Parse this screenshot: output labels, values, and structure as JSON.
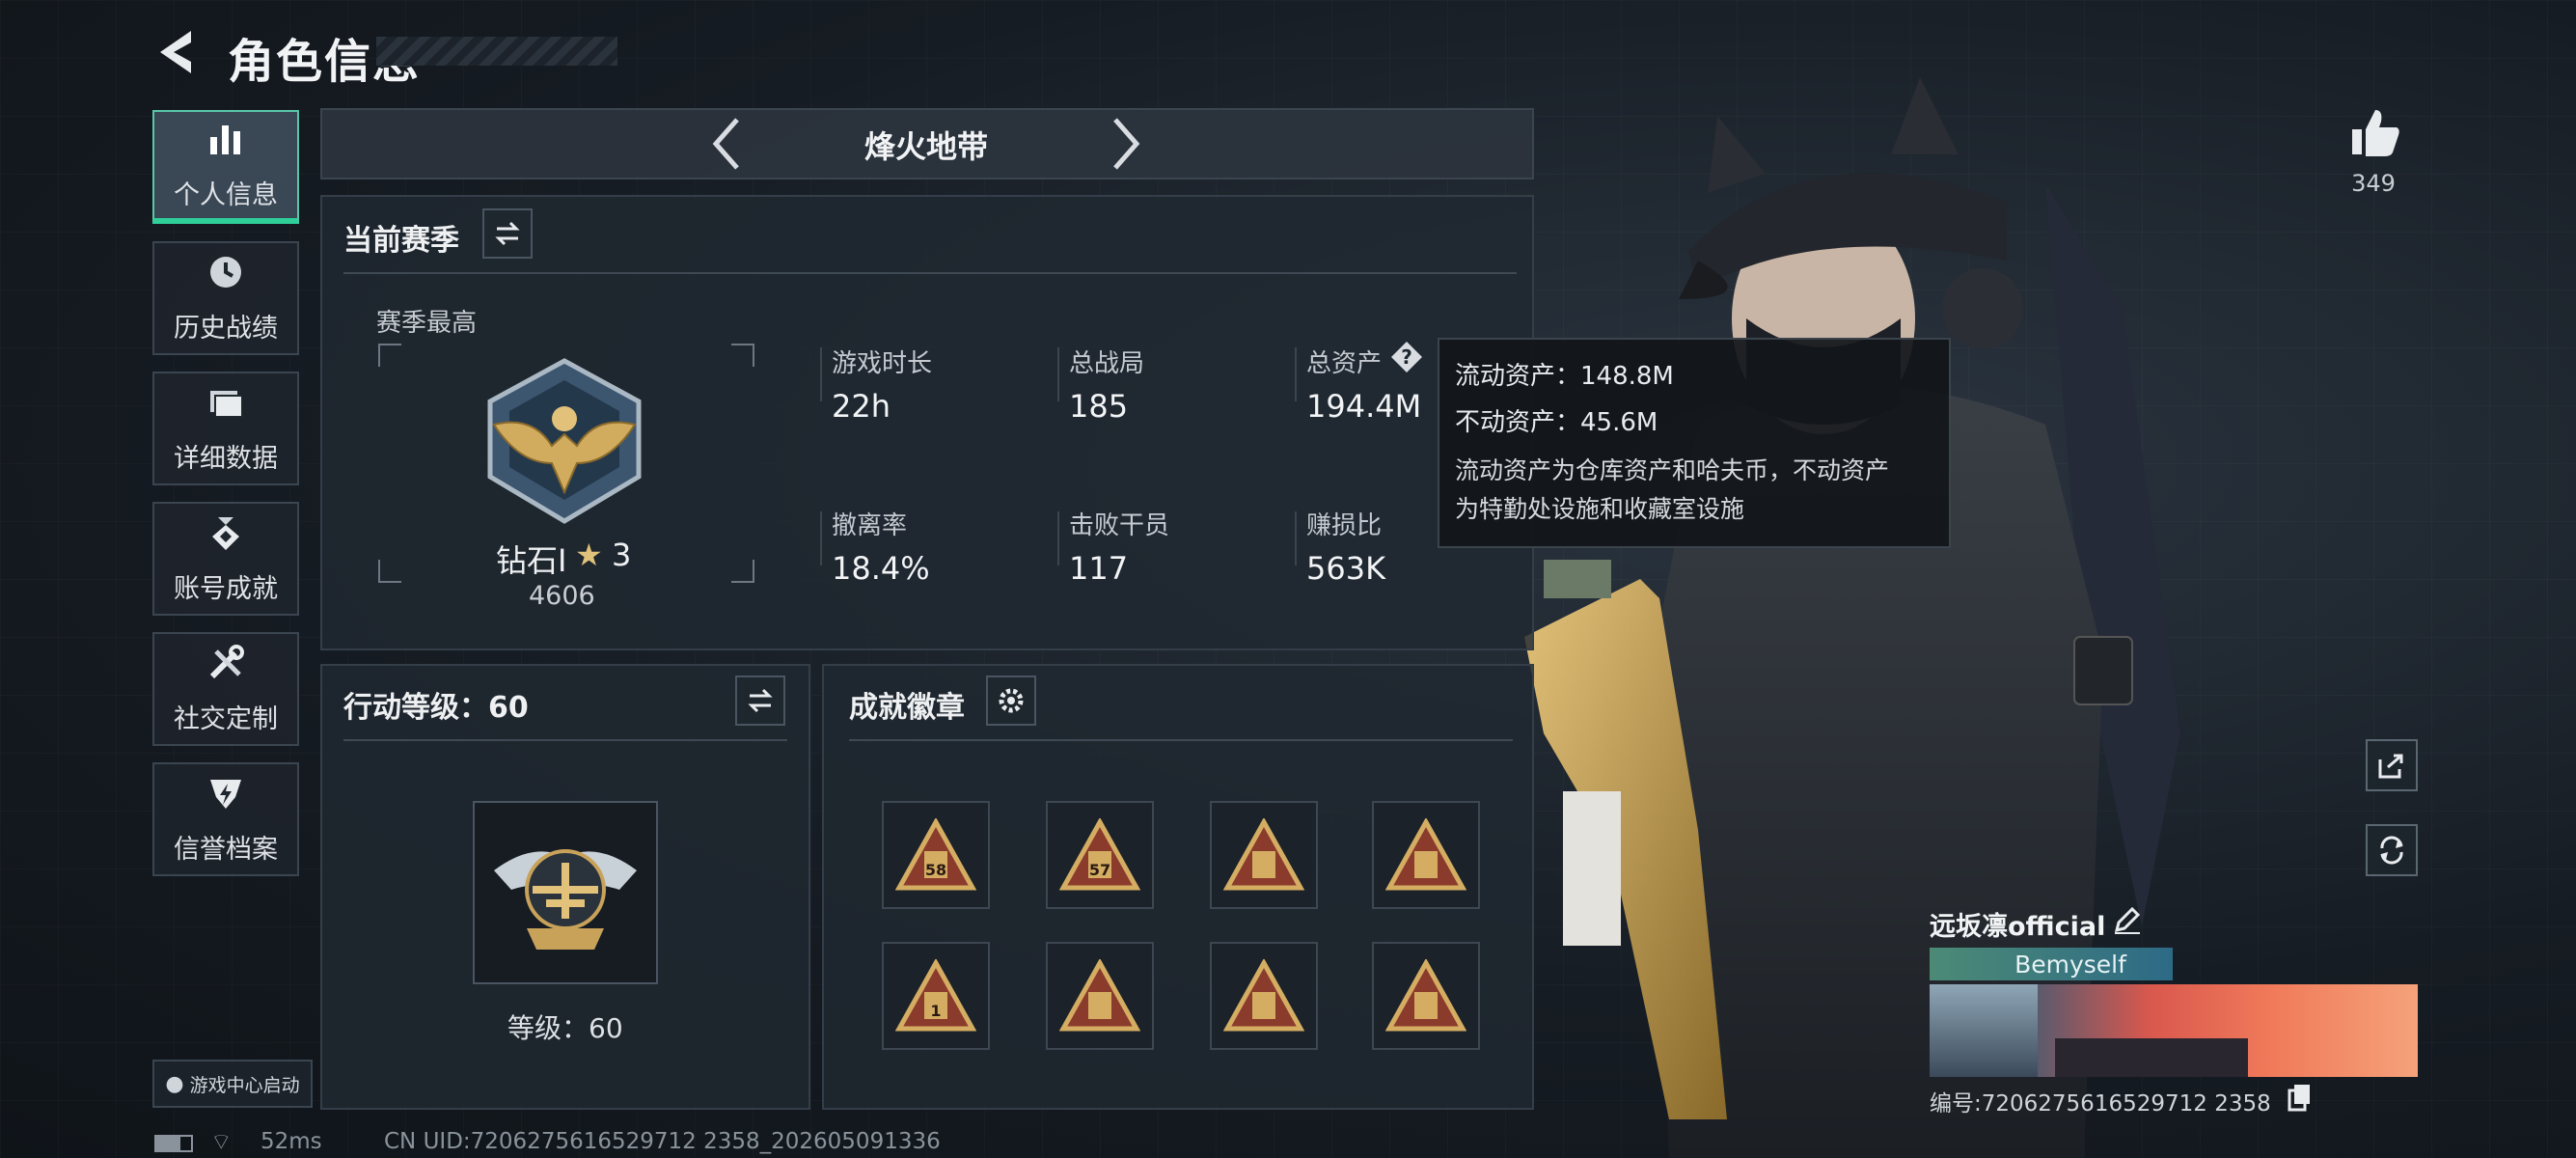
{
  "header": {
    "title": "角色信息"
  },
  "nav": [
    {
      "label": "个人信息",
      "icon": "bar-chart-icon",
      "glyph": "📊",
      "active": true
    },
    {
      "label": "历史战绩",
      "icon": "clock-icon",
      "glyph": "🕓",
      "active": false
    },
    {
      "label": "详细数据",
      "icon": "folder-icon",
      "glyph": "🗀",
      "active": false
    },
    {
      "label": "账号成就",
      "icon": "medal-icon",
      "glyph": "✪",
      "active": false
    },
    {
      "label": "社交定制",
      "icon": "tools-icon",
      "glyph": "🛠",
      "active": false
    },
    {
      "label": "信誉档案",
      "icon": "shield-bolt-icon",
      "glyph": "⛉",
      "active": false
    }
  ],
  "mode_selector": {
    "label": "烽火地带"
  },
  "season": {
    "title": "当前赛季",
    "best_label": "赛季最高",
    "rank_name": "钻石I",
    "rank_stars": "3",
    "rank_points": "4606",
    "stats": [
      {
        "label": "游戏时长",
        "value": "22h"
      },
      {
        "label": "总战局",
        "value": "185"
      },
      {
        "label": "总资产",
        "value": "194.4M"
      },
      {
        "label": "撤离率",
        "value": "18.4%"
      },
      {
        "label": "击败干员",
        "value": "117"
      },
      {
        "label": "赚损比",
        "value": "563K"
      }
    ]
  },
  "tooltip": {
    "liquid": "流动资产：148.8M",
    "fixed": "不动资产：45.6M",
    "desc1": "流动资产为仓库资产和哈夫币，不动资产",
    "desc2": "为特勤处设施和收藏室设施"
  },
  "action_level": {
    "title": "行动等级：60",
    "level_text": "等级：60"
  },
  "achievements": {
    "title": "成就徽章",
    "badges": [
      "58",
      "57",
      "",
      "",
      "1",
      "",
      "",
      ""
    ]
  },
  "likes": {
    "count": "349"
  },
  "profile": {
    "name": "远坂凛official",
    "tag": "Bemyself",
    "id": "编号:7206275616529712 2358"
  },
  "footer": {
    "ping": "52ms",
    "uid": "CN UID:7206275616529712 2358_202605091336",
    "game_center": "游戏中心启动"
  },
  "colors": {
    "accent": "#2fcf9a",
    "gold": "#c9a25a"
  }
}
